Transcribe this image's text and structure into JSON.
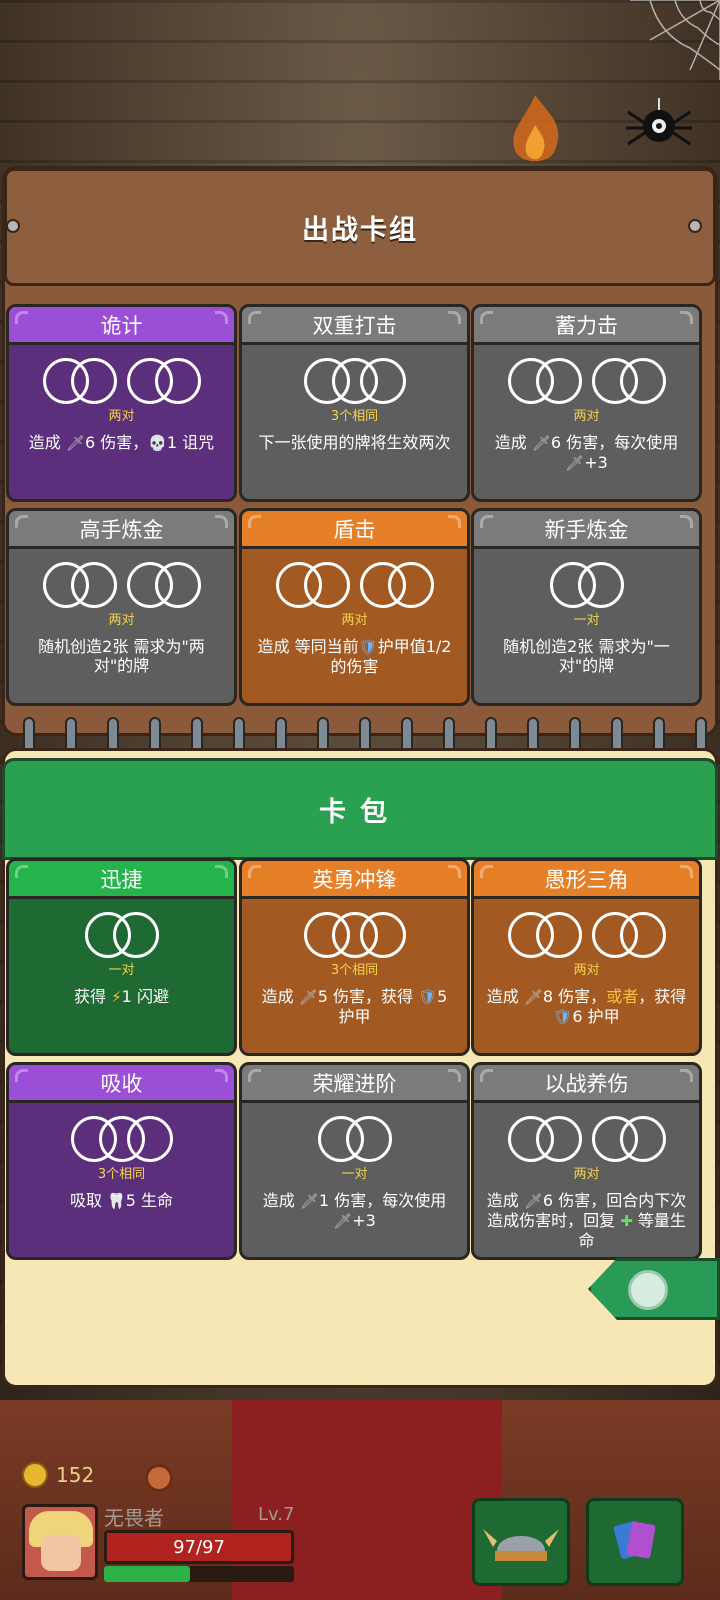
{
  "deck": {
    "title": "出战卡组",
    "cards": [
      {
        "name": "诡计",
        "style": "purple",
        "rings": [
          2,
          2
        ],
        "requirement": "两对",
        "desc_parts": [
          "造成 ",
          "🗡",
          "6 伤害，",
          "💀",
          "1 诅咒"
        ]
      },
      {
        "name": "双重打击",
        "style": "gray",
        "rings": [
          3
        ],
        "requirement": "3个相同",
        "desc_parts": [
          "下一张使用的牌将生效两次"
        ]
      },
      {
        "name": "蓄力击",
        "style": "gray",
        "rings": [
          2,
          2
        ],
        "requirement": "两对",
        "desc_parts": [
          "造成 ",
          "🗡",
          "6 伤害，每次使用 ",
          "🗡",
          "+3"
        ]
      },
      {
        "name": "高手炼金",
        "style": "gray",
        "rings": [
          2,
          2
        ],
        "requirement": "两对",
        "desc_parts": [
          "随机创造2张 需求为\"两对\"的牌"
        ]
      },
      {
        "name": "盾击",
        "style": "orange",
        "rings": [
          2,
          2
        ],
        "requirement": "两对",
        "desc_parts": [
          "造成 等同当前",
          "🛡",
          "护甲值1/2的伤害"
        ]
      },
      {
        "name": "新手炼金",
        "style": "gray",
        "rings": [
          2
        ],
        "requirement": "一对",
        "desc_parts": [
          "随机创造2张 需求为\"一对\"的牌"
        ]
      }
    ]
  },
  "pack": {
    "title": "卡包",
    "cards": [
      {
        "name": "迅捷",
        "style": "green",
        "rings": [
          2
        ],
        "requirement": "一对",
        "desc_parts": [
          "获得 ",
          "⚡",
          "1 闪避"
        ]
      },
      {
        "name": "英勇冲锋",
        "style": "orange",
        "rings": [
          3
        ],
        "requirement": "3个相同",
        "desc_parts": [
          "造成 ",
          "🗡",
          "5 伤害，获得 ",
          "🛡",
          "5 护甲"
        ]
      },
      {
        "name": "愚形三角",
        "style": "orange",
        "rings": [
          2,
          2
        ],
        "requirement": "两对",
        "desc_parts": [
          "造成 ",
          "🗡",
          "8 伤害，",
          "或者",
          "，获得 ",
          "🛡",
          "6 护甲"
        ]
      },
      {
        "name": "吸收",
        "style": "purple",
        "rings": [
          3
        ],
        "requirement": "3个相同",
        "desc_parts": [
          "吸取 ",
          "🦷",
          "5 生命"
        ]
      },
      {
        "name": "荣耀进阶",
        "style": "gray",
        "rings": [
          2
        ],
        "requirement": "一对",
        "desc_parts": [
          "造成 ",
          "🗡",
          "1 伤害，每次使用 ",
          "🗡",
          "+3"
        ]
      },
      {
        "name": "以战养伤",
        "style": "gray",
        "rings": [
          2,
          2
        ],
        "requirement": "两对",
        "desc_parts": [
          "造成 ",
          "🗡",
          "6 伤害，回合内下次造成伤害时，回复 ",
          "✚",
          " 等量生命"
        ]
      }
    ]
  },
  "hud": {
    "coins": "152",
    "player_name": "无畏者",
    "level": "Lv.7",
    "hp": "97/97",
    "xp_fraction": 0.45
  },
  "icons": {
    "sword": "sword-icon",
    "skull": "skull-icon",
    "shield": "shield-icon",
    "lightning": "lightning-icon",
    "fangs": "fangs-icon",
    "heal": "heal-plus-icon"
  },
  "colors": {
    "purple": "#9b4ed6",
    "gray": "#7b7b7b",
    "orange": "#e57f28",
    "green": "#25b34c",
    "requirement": "#f6d54a"
  }
}
